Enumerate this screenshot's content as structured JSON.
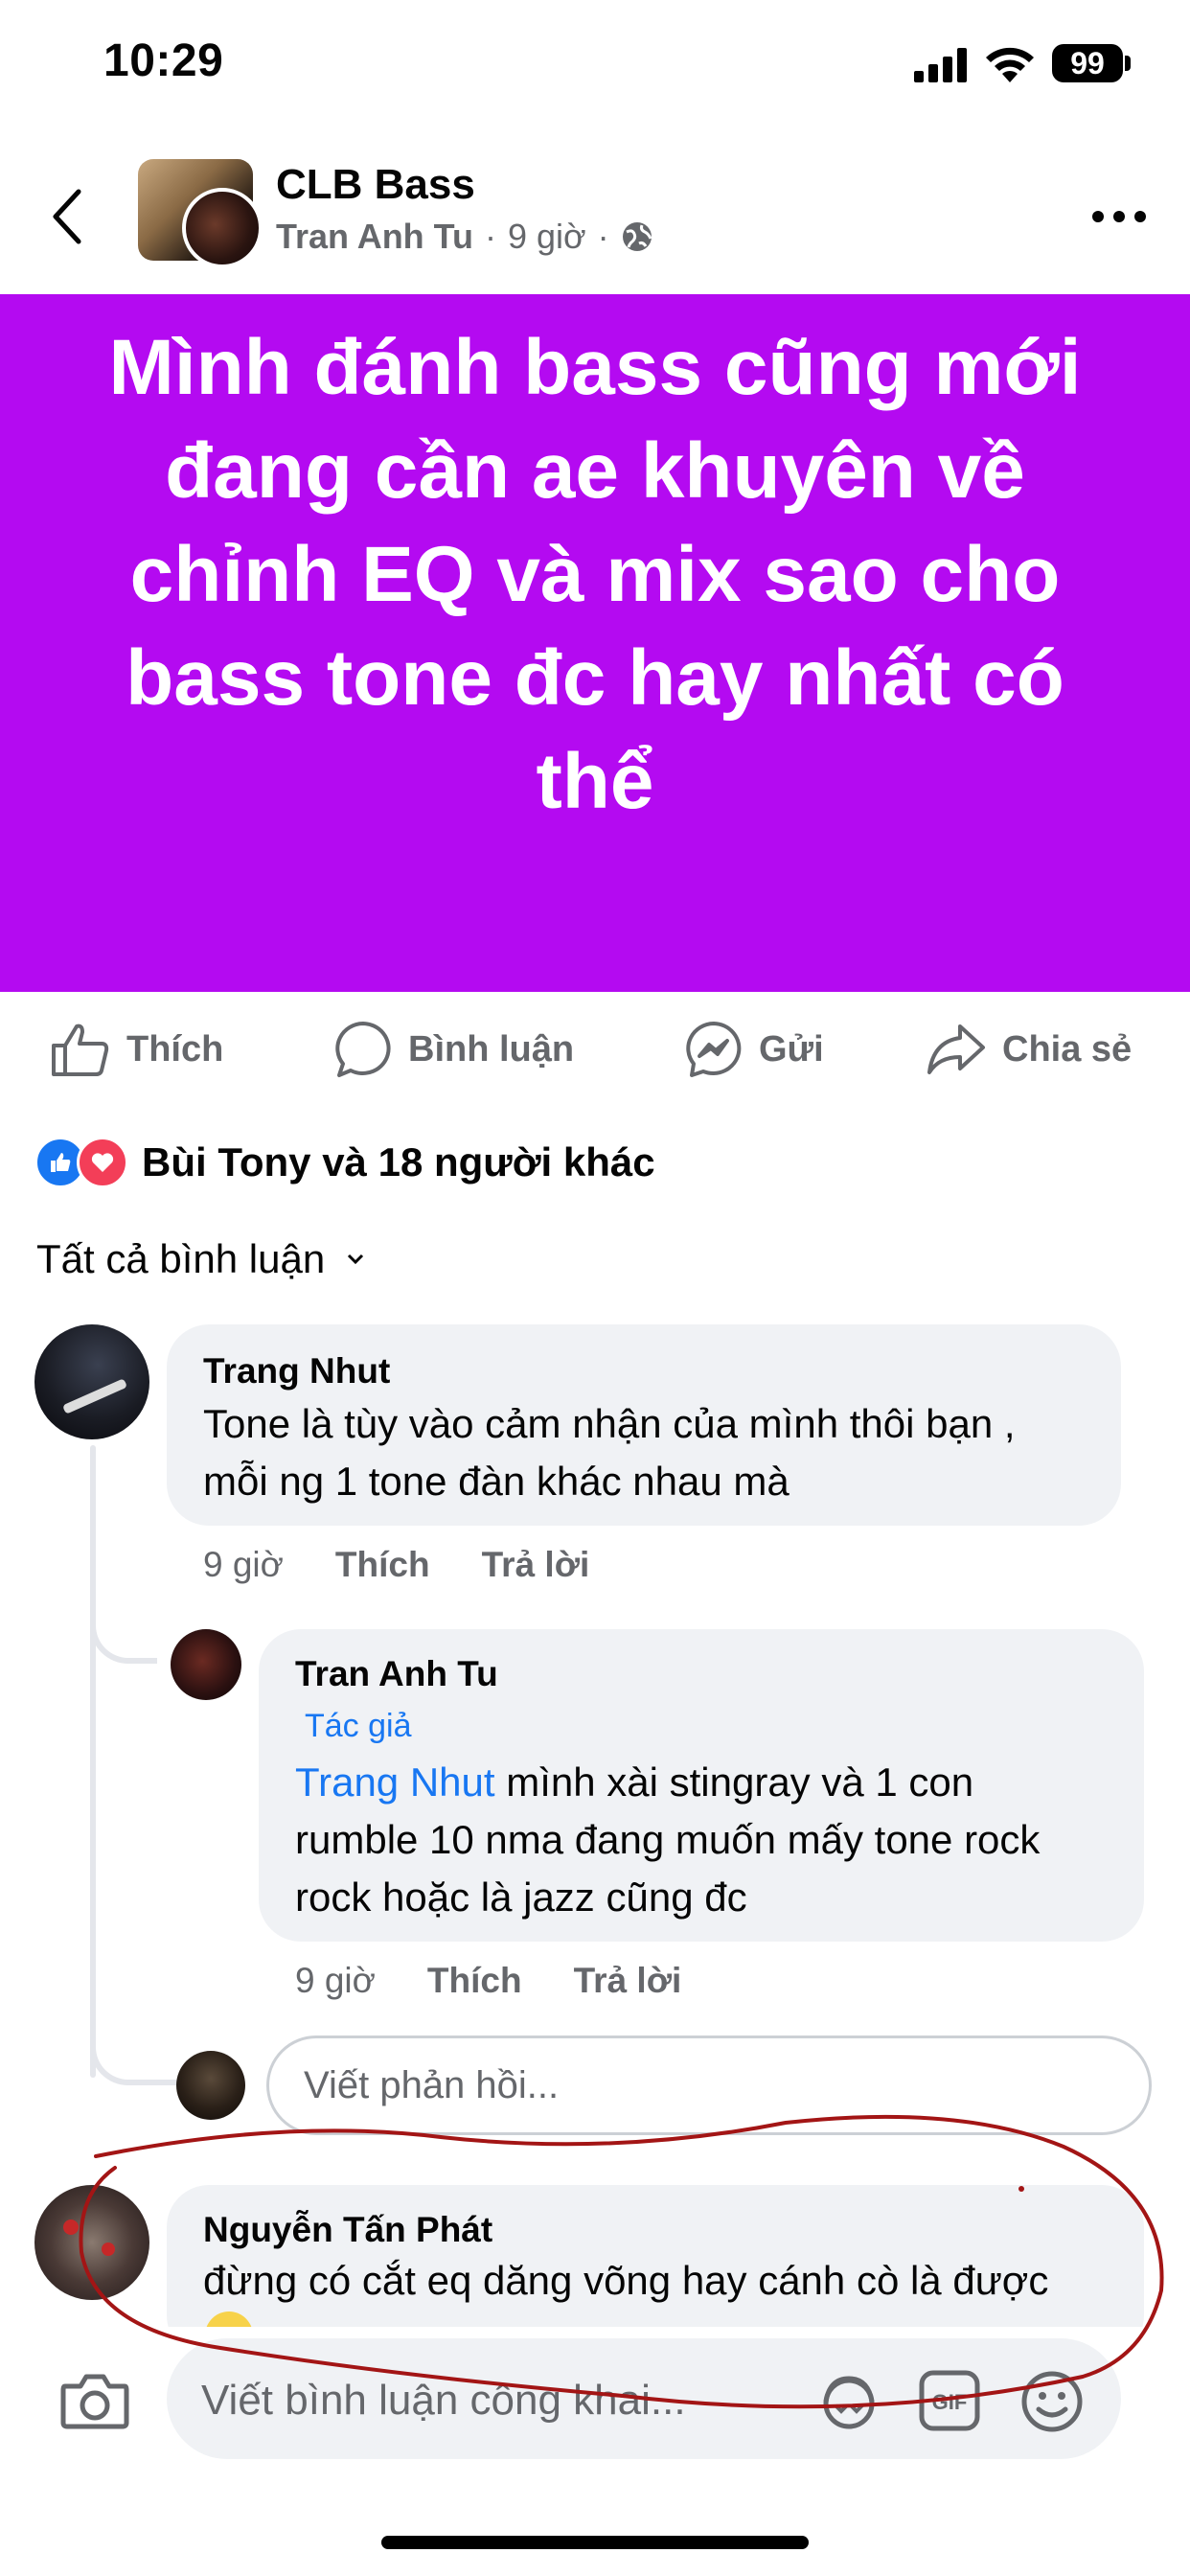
{
  "status_bar": {
    "time": "10:29",
    "battery": "99"
  },
  "header": {
    "group_name": "CLB Bass",
    "author": "Tran Anh Tu",
    "time": "9 giờ",
    "separator": "·"
  },
  "post": {
    "background_color": "#b40af1",
    "text": "Mình đánh bass cũng mới đang cần ae khuyên về chỉnh EQ và mix sao cho bass tone đc hay nhất có thể"
  },
  "actions": {
    "like": "Thích",
    "comment": "Bình luận",
    "send": "Gửi",
    "share": "Chia sẻ"
  },
  "reactions": {
    "summary": "Bùi Tony và 18 người khác"
  },
  "comments_filter": {
    "label": "Tất cả bình luận"
  },
  "comments": [
    {
      "name": "Trang Nhut",
      "text_line1": "Tone là tùy vào cảm nhận của mình thôi bạn ,",
      "text_line2": "mỗi ng 1 tone đàn khác nhau mà",
      "time": "9 giờ",
      "like": "Thích",
      "reply": "Trả lời"
    },
    {
      "name": "Tran Anh Tu",
      "badge": "Tác giả",
      "mention": "Trang Nhut",
      "text_line1": " mình xài stingray và 1 con",
      "text_line2": "rumble 10 nma đang muốn mấy tone rock",
      "text_line3": "rock hoặc là jazz cũng đc",
      "time": "9 giờ",
      "like": "Thích",
      "reply": "Trả lời"
    },
    {
      "name": "Nguyễn Tấn Phát",
      "text_line1": "đừng có cắt eq dăng võng hay cánh cò là được"
    }
  ],
  "reply_input": {
    "placeholder": "Viết phản hồi..."
  },
  "composer": {
    "placeholder": "Viết bình luận công khai..."
  },
  "colors": {
    "accent": "#1877f2",
    "annotation": "#a31515",
    "reaction_heart": "#f33e58"
  }
}
